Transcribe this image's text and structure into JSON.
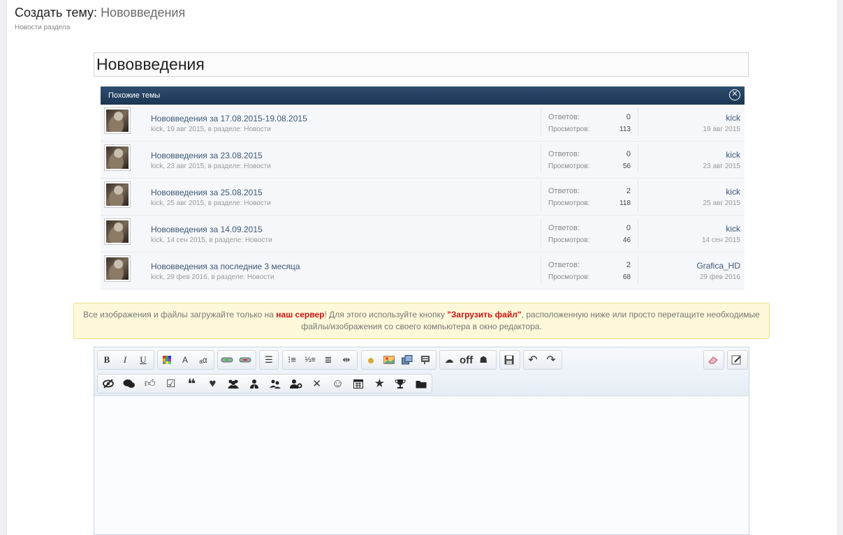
{
  "header": {
    "title_prefix": "Создать тему:",
    "title_topic": "Нововведения",
    "forum_name": "Новости раздела"
  },
  "title_input": {
    "value": "Нововведения"
  },
  "similar_threads": {
    "header": "Похожие темы",
    "replies_label": "Ответов:",
    "views_label": "Просмотров:",
    "rows": [
      {
        "title": "Нововведения за 17.08.2015-19.08.2015",
        "meta": "kick, 19 авг 2015, в разделе: Новости",
        "replies": "0",
        "views": "113",
        "last_user": "kick",
        "last_date": "19 авг 2015"
      },
      {
        "title": "Нововведения за 23.08.2015",
        "meta": "kick, 23 авг 2015, в разделе: Новости",
        "replies": "0",
        "views": "56",
        "last_user": "kick",
        "last_date": "23 авг 2015"
      },
      {
        "title": "Нововведения за 25.08.2015",
        "meta": "kick, 25 авг 2015, в разделе: Новости",
        "replies": "2",
        "views": "118",
        "last_user": "kick",
        "last_date": "25 авг 2015"
      },
      {
        "title": "Нововведения за 14.09.2015",
        "meta": "kick, 14 сен 2015, в разделе: Новости",
        "replies": "0",
        "views": "46",
        "last_user": "kick",
        "last_date": "14 сен 2015"
      },
      {
        "title": "Нововведения за последние 3 месяца",
        "meta": "kick, 29 фев 2016, в разделе: Новости",
        "replies": "2",
        "views": "68",
        "last_user": "Grafica_HD",
        "last_date": "29 фев 2016"
      }
    ]
  },
  "notice": {
    "part1": "Все изображения и файлы загружайте только на ",
    "server_link": "наш сервер",
    "part2": "! Для этого используйте кнопку ",
    "upload_button_name": "\"Загрузить файл\"",
    "part3": ", расположенную ниже или просто перетащите необходимые файлы/изображения со своего компьютера в окно редактора."
  },
  "toolbar": {
    "bold": "B",
    "italic": "I",
    "underline": "U",
    "font_size": "A",
    "font_family": "ₐα",
    "off_label": "off",
    "icon_names": [
      "bold-icon",
      "italic-icon",
      "underline-icon",
      "text-color-icon",
      "font-size-icon",
      "font-family-icon",
      "link-icon",
      "unlink-icon",
      "align-left-icon",
      "bullet-list-icon",
      "numbered-list-icon",
      "indent-icon",
      "outdent-icon",
      "smilie-icon",
      "image-icon",
      "media-icon",
      "quote-icon",
      "hide-icon",
      "spoiler-user-icon",
      "save-icon",
      "undo-icon",
      "redo-icon",
      "remove-format-icon",
      "toggle-source-icon"
    ]
  },
  "toolbar2": {
    "icon_names": [
      "eye-slash-icon",
      "comments-icon",
      "thumbs-up-icon",
      "check-square-icon",
      "quote-left-icon",
      "heart-icon",
      "users-icon",
      "user-tie-icon",
      "user-group-icon",
      "user-plus-icon",
      "times-icon",
      "smile-icon",
      "calendar-icon",
      "star-icon",
      "trophy-icon",
      "folder-icon"
    ]
  }
}
